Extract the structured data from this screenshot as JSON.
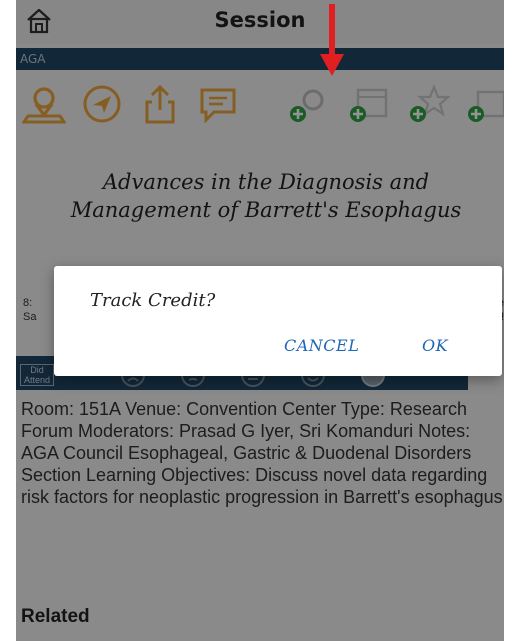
{
  "header": {
    "title": "Session"
  },
  "sponsor": {
    "label": "AGA"
  },
  "session": {
    "title": "Advances in the Diagnosis and Management of Barrett's Esophagus"
  },
  "under_dialog": {
    "left_time": "8:",
    "left_sub": "Sa",
    "right_time": "e",
    "right_sub": "5!"
  },
  "rating": {
    "did_attend": "Did Attend",
    "faces": [
      "very-sad-face-icon",
      "sad-face-icon",
      "neutral-face-icon",
      "happy-face-icon",
      "very-happy-face-icon"
    ]
  },
  "details": {
    "text": "Room: 151A Venue: Convention Center Type: Research Forum Moderators: Prasad G Iyer, Sri Komanduri Notes: AGA Council Esophageal, Gastric & Duodenal Disorders Section Learning Objectives: Discuss novel data regarding risk factors for neoplastic progression in Barrett's esophagus"
  },
  "related": {
    "label": "Related"
  },
  "dialog": {
    "message": "Track Credit?",
    "cancel": "CANCEL",
    "ok": "OK"
  },
  "colors": {
    "accent_orange": "#e9a23a",
    "add_green": "#2e9e46",
    "navy": "#1f4563",
    "arrow_red": "#e02020",
    "dialog_button": "#1f66b8"
  },
  "toolbar_icons": [
    "map-pin-icon",
    "navigate-icon",
    "share-icon",
    "comment-icon",
    "add-search-icon",
    "add-calendar-icon",
    "add-star-icon",
    "add-more-icon"
  ]
}
